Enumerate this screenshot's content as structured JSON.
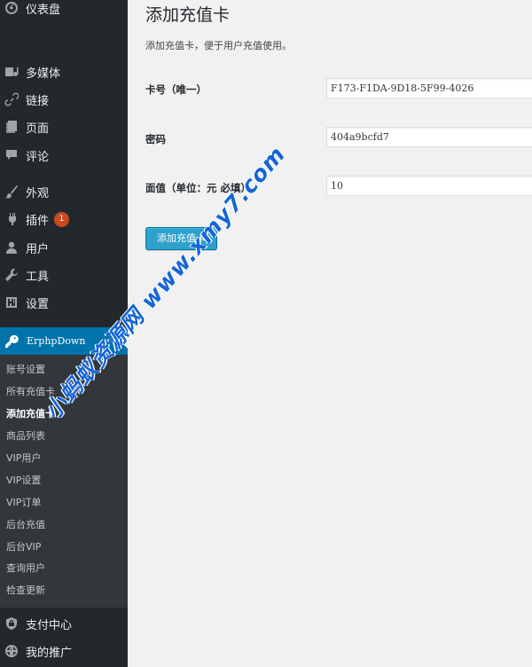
{
  "sidebar": {
    "menu": [
      {
        "label": "仪表盘",
        "icon": "dashboard-icon"
      },
      {
        "label": "多媒体",
        "icon": "media-icon"
      },
      {
        "label": "链接",
        "icon": "link-icon"
      },
      {
        "label": "页面",
        "icon": "page-icon"
      },
      {
        "label": "评论",
        "icon": "comment-icon"
      },
      {
        "label": "外观",
        "icon": "brush-icon"
      },
      {
        "label": "插件",
        "icon": "plugin-icon",
        "badge": "1"
      },
      {
        "label": "用户",
        "icon": "user-icon"
      },
      {
        "label": "工具",
        "icon": "wrench-icon"
      },
      {
        "label": "设置",
        "icon": "settings-icon"
      }
    ],
    "active_menu": {
      "label": "ErphpDown",
      "icon": "key-icon"
    },
    "submenu": [
      {
        "label": "账号设置"
      },
      {
        "label": "所有充值卡"
      },
      {
        "label": "添加充值卡",
        "current": true
      },
      {
        "label": "商品列表"
      },
      {
        "label": "VIP用户"
      },
      {
        "label": "VIP设置"
      },
      {
        "label": "VIP订单"
      },
      {
        "label": "后台充值"
      },
      {
        "label": "后台VIP"
      },
      {
        "label": "查询用户"
      },
      {
        "label": "检查更新"
      }
    ],
    "bottom_menu": [
      {
        "label": "支付中心",
        "icon": "shield-icon"
      },
      {
        "label": "我的推广",
        "icon": "globe-icon"
      }
    ]
  },
  "main": {
    "title": "添加充值卡",
    "description": "添加充值卡，便于用户充值使用。",
    "fields": [
      {
        "label": "卡号（唯一）",
        "value": "F173-F1DA-9D18-5F99-4026"
      },
      {
        "label": "密码",
        "value": "404a9bcfd7"
      },
      {
        "label": "面值（单位：元 必填）",
        "value": "10"
      }
    ],
    "submit_label": "添加充值卡"
  },
  "watermark": "小蚂蚁资源网 www.xmy7.com",
  "colors": {
    "sidebar_bg": "#23282d",
    "submenu_bg": "#32373c",
    "active_bg": "#0073aa",
    "button_bg": "#2ea2cc",
    "badge_bg": "#ca4a1f",
    "watermark": "#1565d8"
  }
}
